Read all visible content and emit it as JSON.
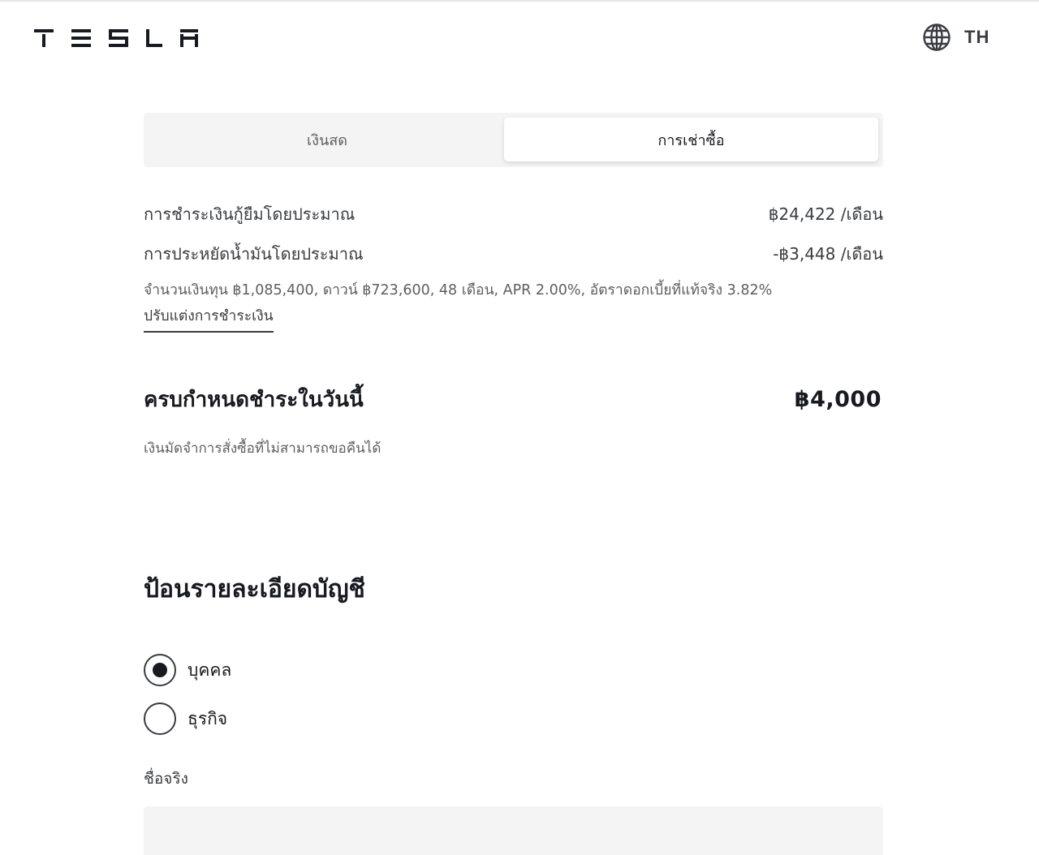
{
  "header": {
    "brand": "TESLA",
    "locale": "TH"
  },
  "payment_tabs": [
    {
      "label": "เงินสด",
      "selected": false
    },
    {
      "label": "การเช่าซื้อ",
      "selected": true
    }
  ],
  "summary": {
    "loan_label": "การชำระเงินกู้ยืมโดยประมาณ",
    "loan_value": "฿24,422 /เดือน",
    "fuel_label": "การประหยัดน้ำมันโดยประมาณ",
    "fuel_value": "-฿3,448 /เดือน",
    "terms": "จำนวนเงินทุน ฿1,085,400, ดาวน์ ฿723,600, 48 เดือน, APR 2.00%, อัตราดอกเบี้ยที่แท้จริง 3.82%",
    "customize_link": "ปรับแต่งการชำระเงิน"
  },
  "due_today": {
    "label": "ครบกำหนดชำระในวันนี้",
    "value": "฿4,000",
    "note": "เงินมัดจำการสั่งซื้อที่ไม่สามารถขอคืนได้"
  },
  "account": {
    "title": "ป้อนรายละเอียดบัญชี",
    "options": [
      {
        "label": "บุคคล",
        "selected": true
      },
      {
        "label": "ธุรกิจ",
        "selected": false
      }
    ],
    "first_name_label": "ชื่อจริง",
    "first_name_value": ""
  },
  "colors": {
    "text_primary": "#171a20",
    "text_secondary": "#393c41",
    "text_muted": "#5c5e62",
    "panel_bg": "#f4f4f4"
  }
}
